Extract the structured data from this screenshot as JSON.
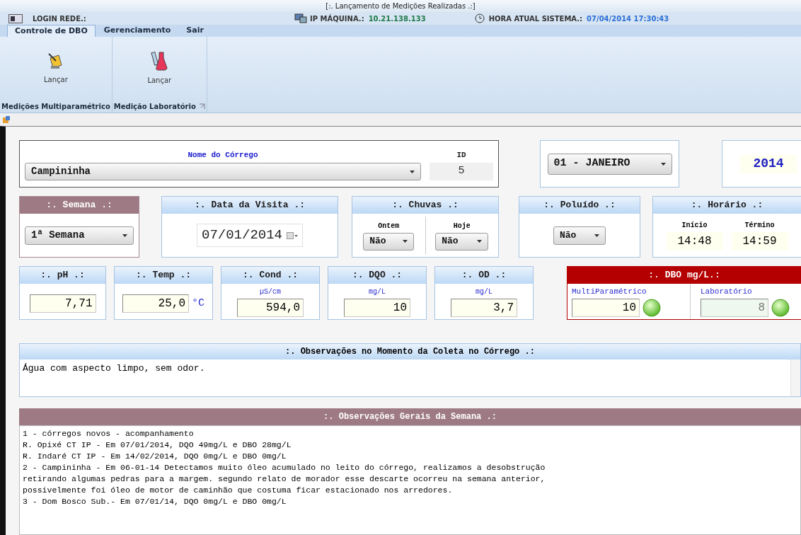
{
  "window": {
    "title": "[:. Lançamento de Medições Realizadas .:]"
  },
  "info_bar": {
    "login_label": "LOGIN REDE.:",
    "ip_label": "IP MÁQUINA.:",
    "ip_value": "10.21.138.133",
    "time_label": "HORA ATUAL SISTEMA.:",
    "time_value": "07/04/2014 17:30:43"
  },
  "tabs": [
    {
      "label": "Controle de DBO",
      "selected": true
    },
    {
      "label": "Gerenciamento",
      "selected": false
    },
    {
      "label": "Sair",
      "selected": false
    }
  ],
  "ribbon_groups": [
    {
      "kind": "meter",
      "button_label": "Lançar",
      "group_label": "Medições Multiparamétrico",
      "launcher": false
    },
    {
      "kind": "flask",
      "button_label": "Lançar",
      "group_label": "Medição Laboratório",
      "launcher": true
    }
  ],
  "form": {
    "stream": {
      "label": "Nome do Córrego",
      "value": "Campininha",
      "id_label": "ID",
      "id_value": "5"
    },
    "month": {
      "value": "01 - JANEIRO"
    },
    "year": {
      "value": "2014"
    },
    "week": {
      "title": ":. Semana .:",
      "value": "1ª Semana"
    },
    "visit_date": {
      "title": ":. Data da Visita .:",
      "value": "07/01/2014"
    },
    "rain": {
      "title": ":. Chuvas .:",
      "yesterday_label": "Ontem",
      "yesterday_value": "Não",
      "today_label": "Hoje",
      "today_value": "Não"
    },
    "polluted": {
      "title": ":. Poluído .:",
      "value": "Não"
    },
    "schedule": {
      "title": ":. Horário .:",
      "start_label": "Início",
      "start_value": "14:48",
      "end_label": "Término",
      "end_value": "14:59"
    },
    "measures": [
      {
        "title": ":. pH .:",
        "value": "7,71"
      },
      {
        "title": ":. Temp .:",
        "value": "25,0",
        "suffix": "°C"
      },
      {
        "title": ":. Cond .:",
        "unit": "µS/cm",
        "value": "594,0"
      },
      {
        "title": ":. DQO .:",
        "unit": "mg/L",
        "value": "10"
      },
      {
        "title": ":. OD .:",
        "unit": "mg/L",
        "value": "3,7"
      }
    ],
    "dbo": {
      "title": ":. DBO mg/L.:",
      "multi_label": "MultiParamétrico",
      "multi_value": "10",
      "lab_label": "Laboratório",
      "lab_value": "8"
    },
    "observations": {
      "title": ":. Observações no Momento da Coleta no Córrego .:",
      "text": "Água com aspecto limpo, sem odor."
    },
    "general_notes": {
      "title": ":. Observações Gerais da Semana .:",
      "lines": [
        "1 - córregos novos - acompanhamento",
        "R. Opixé CT IP - Em 07/01/2014, DQO 49mg/L e DBO 28mg/L",
        "R. Indaré CT IP - Em 14/02/2014, DQO 0mg/L e DBO 0mg/L",
        "2 - Campininha - Em 06-01-14 Detectamos muito óleo acumulado no leito do córrego, realizamos a desobstrução",
        "retirando algumas pedras para a margem. segundo relato de morador esse descarte ocorreu na semana anterior,",
        "possivelmente foi óleo de motor de caminhão que costuma ficar estacionado nos arredores.",
        "3 - Dom Bosco Sub.- Em 07/01/14, DQO 0mg/L e DBO 0mg/L"
      ]
    }
  }
}
